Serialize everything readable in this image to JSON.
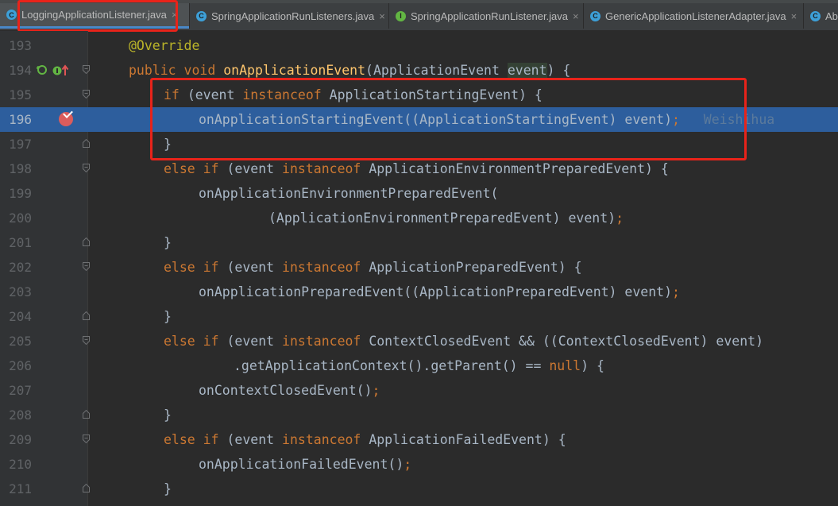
{
  "tabs": [
    {
      "label": "LoggingApplicationListener.java",
      "icon": "class-icon",
      "active": true
    },
    {
      "label": "SpringApplicationRunListeners.java",
      "icon": "class-icon",
      "active": false
    },
    {
      "label": "SpringApplicationRunListener.java",
      "icon": "interface-icon",
      "active": false
    },
    {
      "label": "GenericApplicationListenerAdapter.java",
      "icon": "class-icon",
      "active": false
    },
    {
      "label": "Abs",
      "icon": "class-icon",
      "active": false
    }
  ],
  "tab_close_glyph": "×",
  "tab_icon_letters": {
    "class": "C",
    "interface": "I"
  },
  "inline_hint": "Weishihua",
  "lines": {
    "193": {
      "num": "193",
      "t1": "@Override"
    },
    "194": {
      "num": "194",
      "t1": "public void ",
      "t2": "onApplicationEvent",
      "t3": "(ApplicationEvent ",
      "t4": "event",
      "t5": ") {"
    },
    "195": {
      "num": "195",
      "t1": "if ",
      "t2": "(event ",
      "t3": "instanceof ",
      "t4": "ApplicationStartingEvent) {"
    },
    "196": {
      "num": "196",
      "t1": "onApplicationStartingEvent((ApplicationStartingEvent) event)",
      "t2": ";"
    },
    "197": {
      "num": "197",
      "t1": "}"
    },
    "198": {
      "num": "198",
      "t1": "else if ",
      "t2": "(event ",
      "t3": "instanceof ",
      "t4": "ApplicationEnvironmentPreparedEvent) {"
    },
    "199": {
      "num": "199",
      "t1": "onApplicationEnvironmentPreparedEvent("
    },
    "200": {
      "num": "200",
      "t1": "(ApplicationEnvironmentPreparedEvent) event)",
      "t2": ";"
    },
    "201": {
      "num": "201",
      "t1": "}"
    },
    "202": {
      "num": "202",
      "t1": "else if ",
      "t2": "(event ",
      "t3": "instanceof ",
      "t4": "ApplicationPreparedEvent) {"
    },
    "203": {
      "num": "203",
      "t1": "onApplicationPreparedEvent((ApplicationPreparedEvent) event)",
      "t2": ";"
    },
    "204": {
      "num": "204",
      "t1": "}"
    },
    "205": {
      "num": "205",
      "t1": "else if ",
      "t2": "(event ",
      "t3": "instanceof ",
      "t4": "ContextClosedEvent && ((ContextClosedEvent) event)"
    },
    "206": {
      "num": "206",
      "t1": ".getApplicationContext().getParent() == ",
      "t2": "null",
      "t3": ") {"
    },
    "207": {
      "num": "207",
      "t1": "onContextClosedEvent()",
      "t2": ";"
    },
    "208": {
      "num": "208",
      "t1": "}"
    },
    "209": {
      "num": "209",
      "t1": "else if ",
      "t2": "(event ",
      "t3": "instanceof ",
      "t4": "ApplicationFailedEvent) {"
    },
    "210": {
      "num": "210",
      "t1": "onApplicationFailedEvent()",
      "t2": ";"
    },
    "211": {
      "num": "211",
      "t1": "}"
    }
  },
  "colors": {
    "background": "#2b2b2b",
    "gutter": "#313335",
    "keyword": "#cc7832",
    "annotation": "#bbb529",
    "method_declaration": "#ffc66d",
    "text": "#a9b7c6",
    "execution_line": "#2d5e9d",
    "breakpoint": "#db5c5c",
    "annotation_box": "#e8231a"
  }
}
